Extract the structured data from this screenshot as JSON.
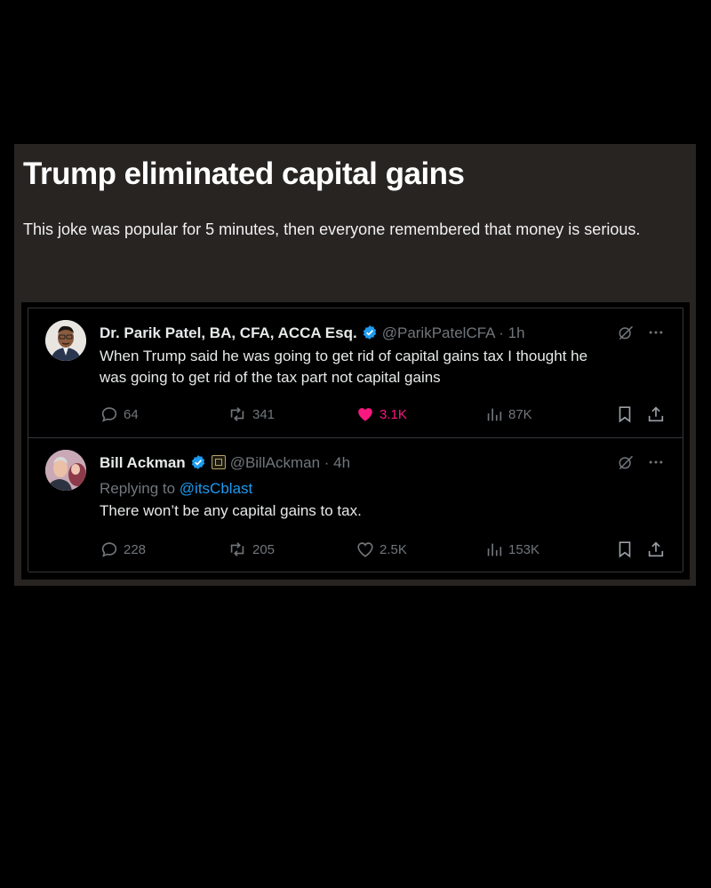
{
  "article": {
    "title": "Trump eliminated capital gains",
    "subtitle": "This joke was popular for 5 minutes, then everyone remembered that money is serious."
  },
  "tweets": [
    {
      "name": "Dr. Parik Patel, BA, CFA, ACCA Esq.",
      "handle": "@ParikPatelCFA · 1h",
      "verified": true,
      "text_lines": [
        "When Trump said he was going to get rid of capital gains tax I thought he",
        "was going to get rid of the tax part not capital gains"
      ],
      "replies": "64",
      "retweets": "341",
      "likes": "3.1K",
      "liked": true,
      "views": "87K"
    },
    {
      "name": "Bill Ackman",
      "handle": "@BillAckman · 4h",
      "verified": true,
      "replying_prefix": "Replying to",
      "replying_to": "@itsCblast",
      "text_lines": [
        "There won’t be any capital gains to tax."
      ],
      "replies": "228",
      "retweets": "205",
      "likes": "2.5K",
      "liked": false,
      "views": "153K"
    }
  ],
  "colors": {
    "accent_blue": "#1d9bf0",
    "like_pink": "#f91880",
    "muted": "#71767b",
    "card_bg": "#272422"
  },
  "icons": [
    "verified-badge-icon",
    "grok-icon",
    "more-icon",
    "reply-icon",
    "retweet-icon",
    "like-icon",
    "views-icon",
    "bookmark-icon",
    "share-icon",
    "affiliate-badge-icon"
  ]
}
